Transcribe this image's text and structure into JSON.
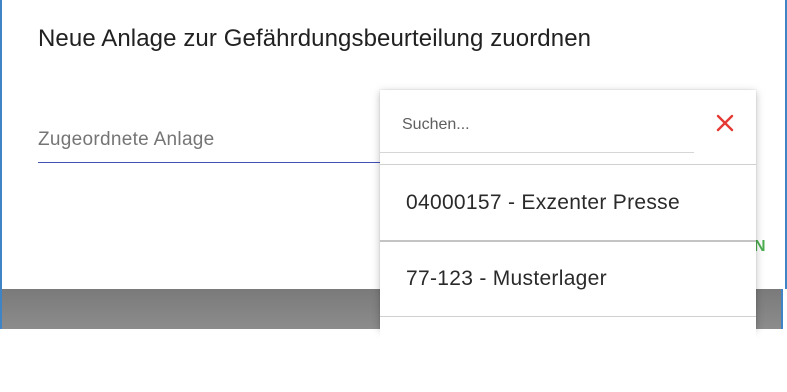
{
  "dialog": {
    "title": "Neue Anlage zur Gefährdungsbeurteilung zuordnen",
    "field_label": "Zugeordnete Anlage",
    "action_fragment": "N"
  },
  "dropdown": {
    "search_placeholder": "Suchen...",
    "close_icon": "close-icon",
    "options": [
      {
        "label": "04000157 - Exzenter Presse"
      },
      {
        "label": "77-123 - Musterlager"
      }
    ]
  },
  "colors": {
    "accent": "#3f51b5",
    "close": "#e53935",
    "action": "#4caf50",
    "frame": "#3f85c6"
  }
}
